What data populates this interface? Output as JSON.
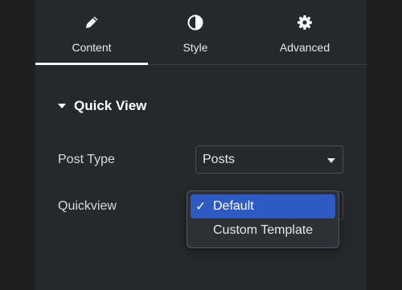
{
  "tabs": [
    {
      "label": "Content",
      "icon": "pencil-icon",
      "active": true
    },
    {
      "label": "Style",
      "icon": "half-circle-icon",
      "active": false
    },
    {
      "label": "Advanced",
      "icon": "gear-icon",
      "active": false
    }
  ],
  "section": {
    "title": "Quick View"
  },
  "fields": {
    "post_type": {
      "label": "Post Type",
      "value": "Posts"
    },
    "quickview": {
      "label": "Quickview"
    }
  },
  "dropdown": {
    "options": [
      {
        "label": "Default",
        "selected": true,
        "check": "✓"
      },
      {
        "label": "Custom Template",
        "selected": false
      }
    ]
  },
  "colors": {
    "panel": "#26292c",
    "selection": "#2e5ac4",
    "text": "#e6e8ea"
  }
}
